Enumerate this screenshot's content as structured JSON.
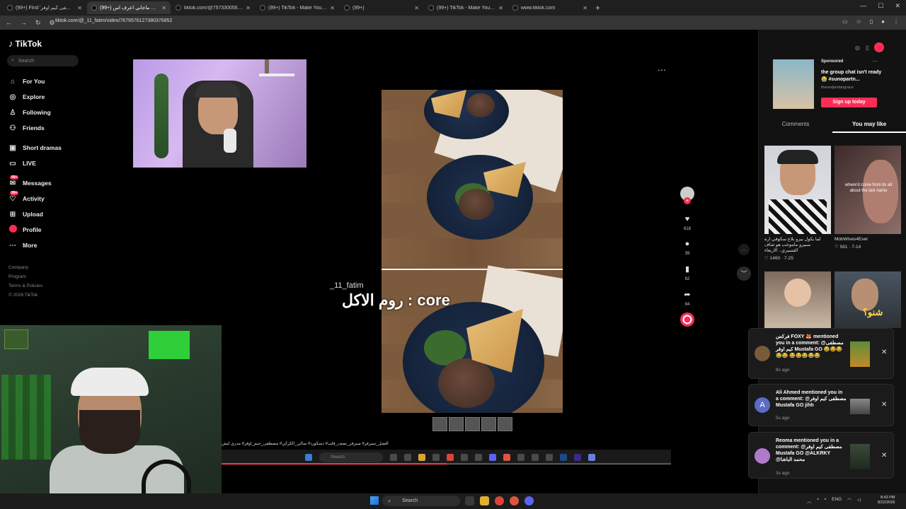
{
  "browser": {
    "tabs": [
      {
        "label": "(99+) Find 'مصطفى كيم اوفر' on"
      },
      {
        "label": "(99+) مدري ليش ماجاني اعرف اس"
      },
      {
        "label": "tiktok.com/@7573300562192"
      },
      {
        "label": "(99+) TikTok - Make Your Day"
      },
      {
        "label": "(99+)"
      },
      {
        "label": "(99+) TikTok - Make Your Day"
      },
      {
        "label": "www.tiktok.com"
      }
    ],
    "url": "tiktok.com/@_11_fatim/video/7676576127380376852"
  },
  "sidebar": {
    "logo": "TikTok",
    "search_placeholder": "Search",
    "nav": [
      {
        "label": "For You",
        "icon": "home-icon"
      },
      {
        "label": "Explore",
        "icon": "compass-icon"
      },
      {
        "label": "Following",
        "icon": "following-icon"
      },
      {
        "label": "Friends",
        "icon": "friends-icon"
      },
      {
        "label": "Short dramas",
        "icon": "dramas-icon"
      },
      {
        "label": "LIVE",
        "icon": "live-icon"
      },
      {
        "label": "Messages",
        "icon": "messages-icon",
        "badge": "99+"
      },
      {
        "label": "Activity",
        "icon": "activity-icon",
        "badge": "99+"
      },
      {
        "label": "Upload",
        "icon": "upload-icon"
      },
      {
        "label": "Profile",
        "icon": "profile-icon"
      },
      {
        "label": "More",
        "icon": "more-icon"
      }
    ],
    "footer": [
      "Company",
      "Program",
      "Terms & Policies",
      "© 2026 TikTok"
    ]
  },
  "video": {
    "username": "_11_fatim",
    "caption": "روم الاكل : core",
    "hashtags": "أفضل_سيرفر# سيرفر_نصف_قلب# دسكورد# سالي_الكركي# مصطفى_جيم_اوفر# مدري ليش",
    "progress": 0.5
  },
  "actions": {
    "likes": "618",
    "comments": "39",
    "saves": "62",
    "shares": "94"
  },
  "right_panel": {
    "ad": {
      "sponsored": "Sponsored",
      "title": "the group chat isn't ready 😭 #sunopartn...",
      "handle": "therealjordangrace",
      "cta": "Sign up today"
    },
    "tabs": [
      "Comments",
      "You may like"
    ],
    "active_tab": "You may like",
    "cards": [
      {
        "caption": "لما يكول بيرو بلاع سكوفي اره سبيرو ماموجب هو شاف الفسيري.. الاربعاء",
        "meta": "♡ 1460 · 7-25"
      },
      {
        "caption": "MobWives4Ever",
        "meta": "♡ 561 · 7-14",
        "overlay": "where'd come from its all about the last name"
      },
      {
        "caption": "",
        "meta": ""
      },
      {
        "caption": "",
        "meta": "",
        "overlay": "شنو؟"
      }
    ]
  },
  "notifications": [
    {
      "text": "فركس FOXY 🦊 mentioned you in a comment: @مصطفى كيم اوفر Mustafa GO 😂😂😂😂😂 😂😂😂😂😂",
      "time": "8s ago"
    },
    {
      "text": "Ali Ahmed mentioned you in a comment: @مصطفى كيم اوفر Mustafa GO jihh",
      "time": "5s ago",
      "initial": "A"
    },
    {
      "text": "Reoma mentioned you in a comment: @مصطفى كيم اوفر Mustafa GO @ALKRKY @محمد الباشا",
      "time": "3s ago"
    }
  ],
  "inner_taskbar": {
    "search": "Search"
  },
  "taskbar": {
    "search": "Search",
    "tray_lang": "ENG",
    "time": "8:43 PM",
    "date": "8/22/2026"
  }
}
